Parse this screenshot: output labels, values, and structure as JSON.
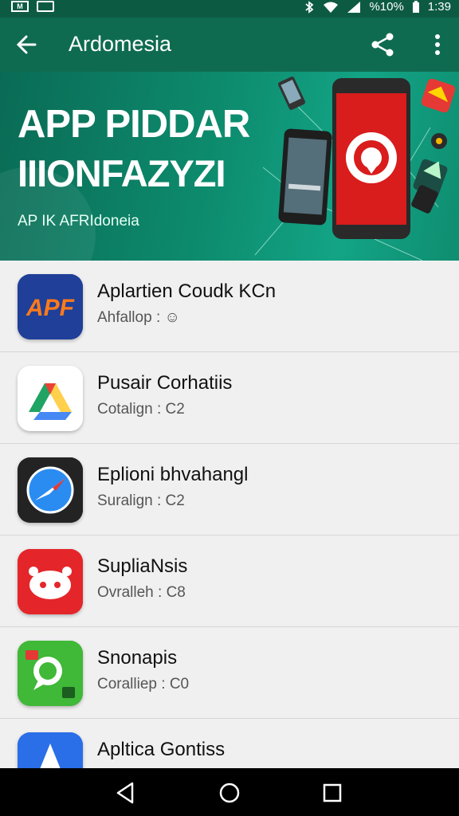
{
  "status_bar": {
    "left_icons": [
      "notification-icon",
      "message-icon"
    ],
    "left_texts": [
      "M",
      ""
    ],
    "right_icons": [
      "bluetooth-icon",
      "wifi-icon",
      "signal-icon",
      "battery-icon"
    ],
    "battery": "%10%",
    "time": "1:39"
  },
  "toolbar": {
    "title": "Ardomesia",
    "back_icon": "arrow-back-icon",
    "share_icon": "share-icon",
    "more_icon": "more-vert-icon",
    "color": "#0f6b50"
  },
  "banner": {
    "headline_1": "APP PIDDAR",
    "headline_2": "IIIONFAZYZI",
    "subtitle": "AP IK AFRIdoneia"
  },
  "apps": [
    {
      "name": "Aplartien Coudk KCn",
      "meta": "Ahfallop : ☺",
      "icon": "apf-app-icon",
      "icon_text": "APF",
      "color": "#1e3a8a"
    },
    {
      "name": "Pusair Corhatiis",
      "meta": "Cotalign : C2",
      "icon": "drive-app-icon",
      "color": "#ffffff"
    },
    {
      "name": "Eplioni bhvahangl",
      "meta": "Suralign : C2",
      "icon": "compass-app-icon",
      "color": "#222222"
    },
    {
      "name": "SupliaNsis",
      "meta": "Ovralleh : C8",
      "icon": "robot-app-icon",
      "color": "#e02424"
    },
    {
      "name": "Snonapis",
      "meta": "Coralliep : C0",
      "icon": "chat-app-icon",
      "color": "#3fb52f"
    },
    {
      "name": "Apltica Gontiss",
      "meta": "",
      "icon": "navigation-app-icon",
      "color": "#2563eb"
    }
  ],
  "nav_bar": {
    "back": "nav-back-icon",
    "home": "nav-home-icon",
    "recents": "nav-recents-icon"
  }
}
